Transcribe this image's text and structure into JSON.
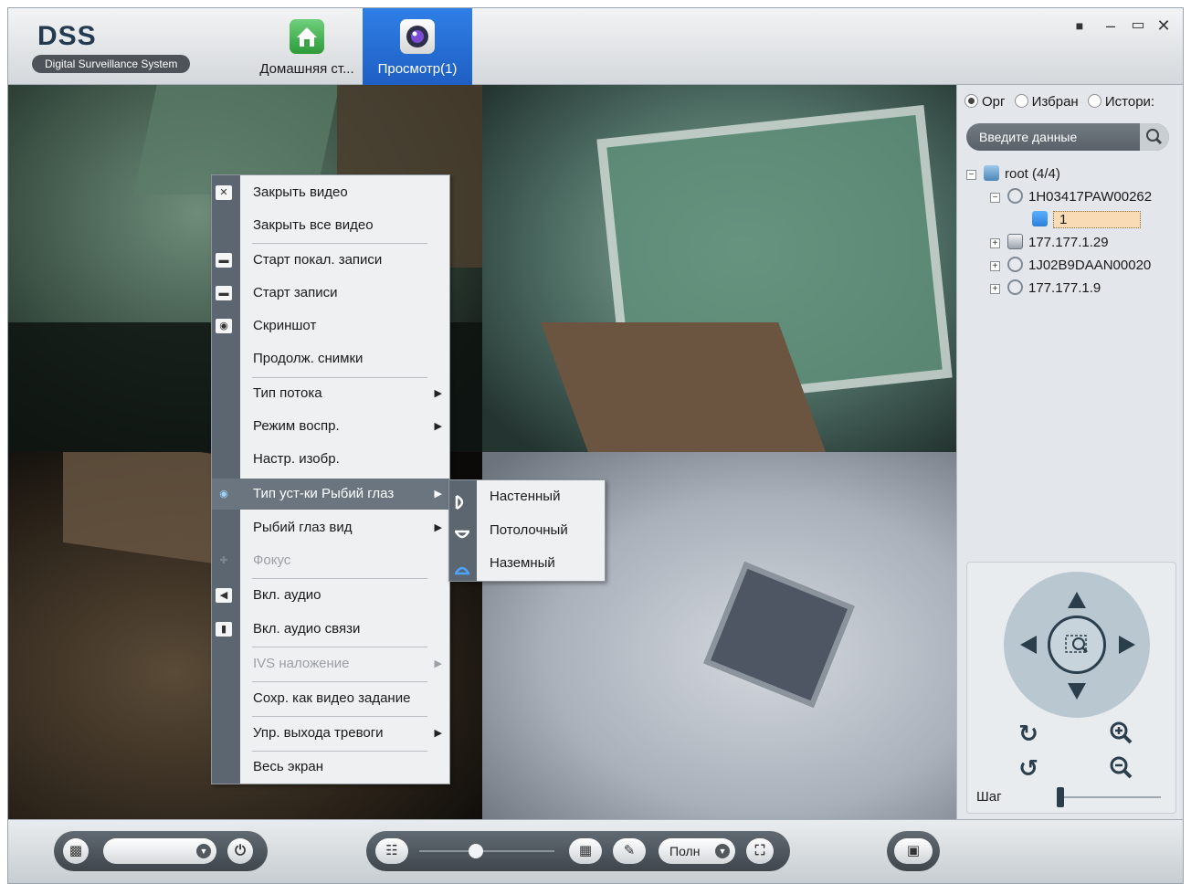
{
  "app": {
    "logo": "DSS",
    "subtitle": "Digital Surveillance System",
    "tabs": [
      {
        "label": "Домашняя ст...",
        "icon": "home-icon",
        "active": false
      },
      {
        "label": "Просмотр(1)",
        "icon": "camera-lens-icon",
        "active": true
      }
    ],
    "window_controls": [
      "lock-icon",
      "minimize-icon",
      "maximize-icon",
      "close-icon"
    ]
  },
  "context_menu": {
    "items": [
      {
        "label": "Закрыть видео",
        "icon": "close-video-icon"
      },
      {
        "label": "Закрыть все видео"
      },
      {
        "label": "Старт покал. записи",
        "icon": "local-record-icon"
      },
      {
        "label": "Старт записи",
        "icon": "record-icon"
      },
      {
        "label": "Скриншот",
        "icon": "snapshot-icon"
      },
      {
        "label": "Продолж. снимки"
      },
      {
        "label": "Тип потока",
        "submenu": true
      },
      {
        "label": "Режим воспр.",
        "submenu": true
      },
      {
        "label": "Настр. изобр."
      },
      {
        "label": "Тип уст-ки Рыбий глаз",
        "submenu": true,
        "highlighted": true,
        "icon": "fisheye-eye-icon"
      },
      {
        "label": "Рыбий глаз вид",
        "submenu": true
      },
      {
        "label": "Фокус",
        "disabled": true,
        "icon": "focus-icon"
      },
      {
        "label": "Вкл. аудио",
        "icon": "speaker-icon"
      },
      {
        "label": "Вкл. аудио связи",
        "icon": "microphone-icon"
      },
      {
        "label": "IVS наложение",
        "submenu": true,
        "disabled": true
      },
      {
        "label": "Сохр. как видео задание"
      },
      {
        "label": "Упр. выхода тревоги",
        "submenu": true
      },
      {
        "label": "Весь экран"
      }
    ],
    "submenu": [
      {
        "label": "Настенный",
        "icon": "wall-mount-icon"
      },
      {
        "label": "Потолочный",
        "icon": "ceiling-mount-icon"
      },
      {
        "label": "Наземный",
        "icon": "ground-mount-icon"
      }
    ]
  },
  "side": {
    "radios": [
      {
        "label": "Орг",
        "checked": true
      },
      {
        "label": "Избран",
        "checked": false
      },
      {
        "label": "Истори:",
        "checked": false
      }
    ],
    "search_placeholder": "Введите данные",
    "tree": {
      "root": "root (4/4)",
      "device1": "1H03417PAW00262",
      "channel1": "1",
      "device2": "177.177.1.29",
      "device3": "1J02B9DAAN00020",
      "device4": "177.177.1.9"
    },
    "ptz": {
      "step_label": "Шаг"
    }
  },
  "bottom": {
    "stream_mode": "Полн"
  }
}
